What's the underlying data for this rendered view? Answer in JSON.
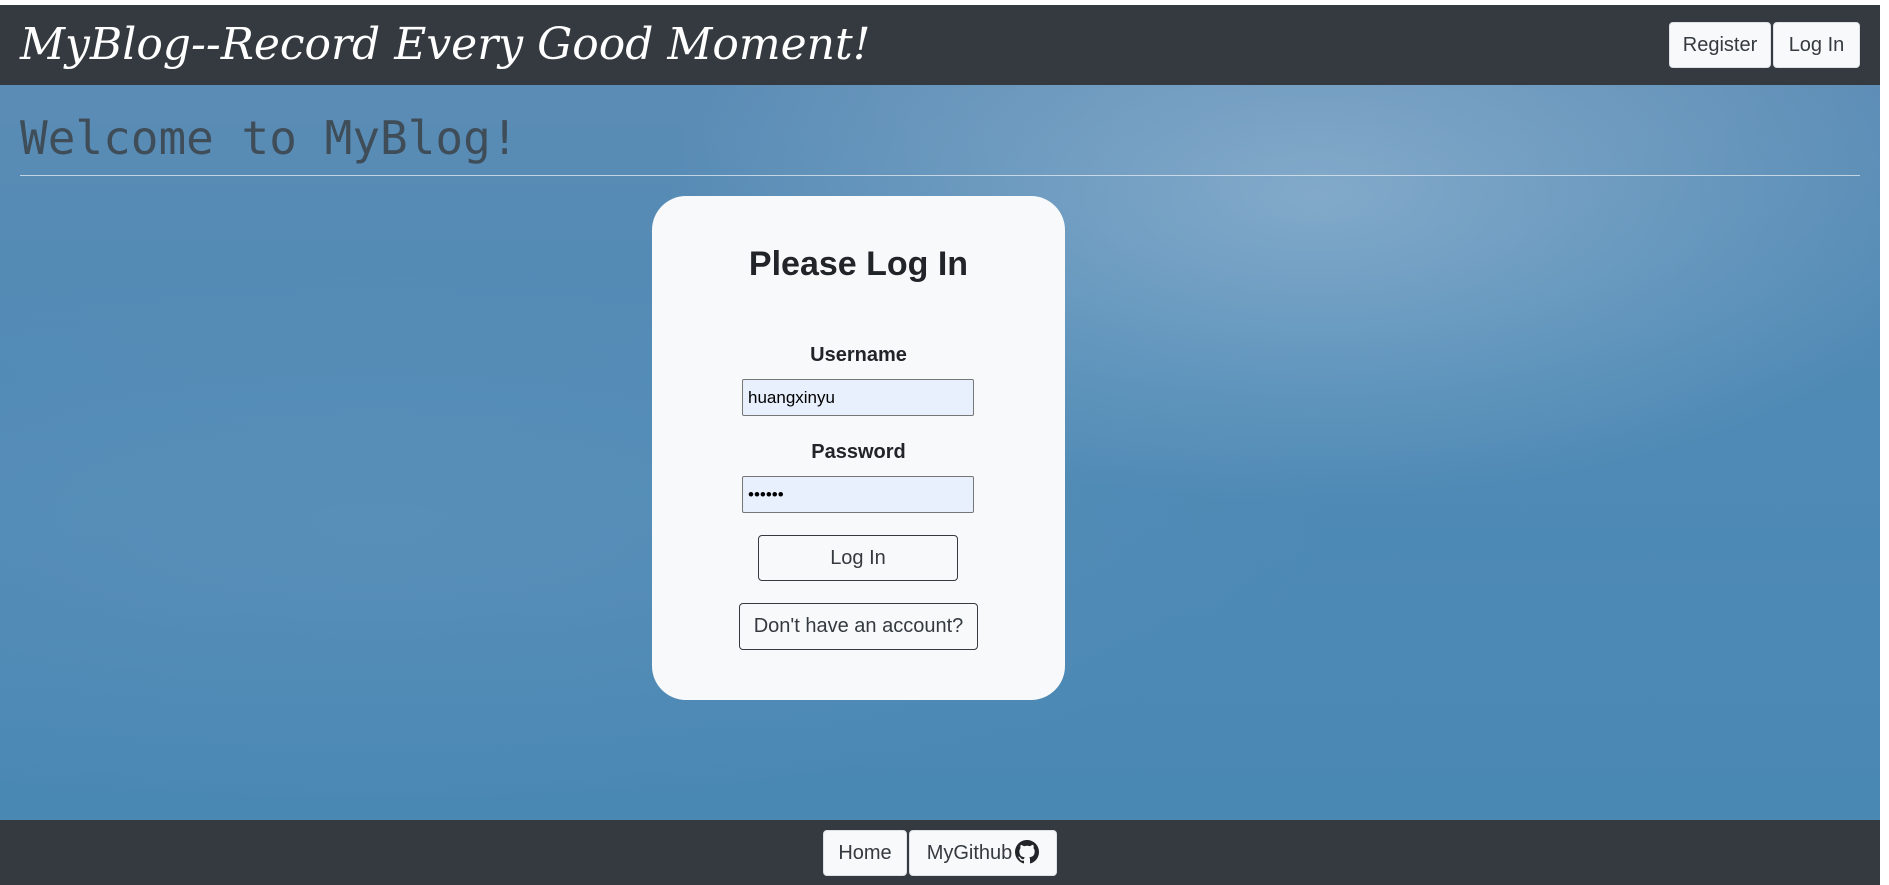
{
  "header": {
    "brand": "MyBlog--Record Every Good Moment!",
    "register_label": "Register",
    "login_label": "Log In"
  },
  "main": {
    "welcome": "Welcome to MyBlog!"
  },
  "login_card": {
    "title": "Please Log In",
    "username_label": "Username",
    "username_value": "huangxinyu",
    "password_label": "Password",
    "password_value": "••••••",
    "submit_label": "Log In",
    "signup_label": "Don't have an account?"
  },
  "footer": {
    "home_label": "Home",
    "github_label": "MyGithub",
    "github_icon": "github-icon"
  },
  "colors": {
    "navbar": "#343a40",
    "card": "#f8f9fa",
    "input_fill": "#e8f0fe",
    "background_blue": "#4f8ab5"
  }
}
